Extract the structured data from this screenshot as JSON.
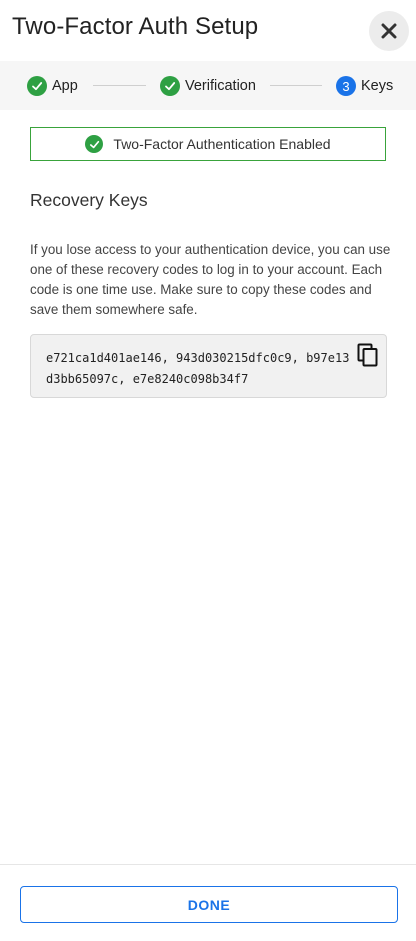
{
  "header": {
    "title": "Two-Factor Auth Setup",
    "close_icon": "close-icon"
  },
  "stepper": {
    "steps": [
      {
        "label": "App",
        "status": "done",
        "icon": "check-icon"
      },
      {
        "label": "Verification",
        "status": "done",
        "icon": "check-icon"
      },
      {
        "label": "Keys",
        "status": "active",
        "number": "3"
      }
    ]
  },
  "banner": {
    "text": "Two-Factor Authentication Enabled",
    "icon": "check-icon"
  },
  "recovery": {
    "title": "Recovery Keys",
    "description": "If you lose access to your authentication device, you can use one of these recovery codes to log in to your account. Each code is one time use. Make sure to copy these codes and save them somewhere safe.",
    "codes": "e721ca1d401ae146, 943d030215dfc0c9, b97e13d3bb65097c, e7e8240c098b34f7",
    "copy_icon": "copy-icon"
  },
  "footer": {
    "done_label": "DONE"
  },
  "colors": {
    "success": "#2ea043",
    "accent": "#1a73e8",
    "banner_border": "#39a33b",
    "stepper_bg": "#f6f6f6",
    "code_bg": "#f1f1f1"
  }
}
